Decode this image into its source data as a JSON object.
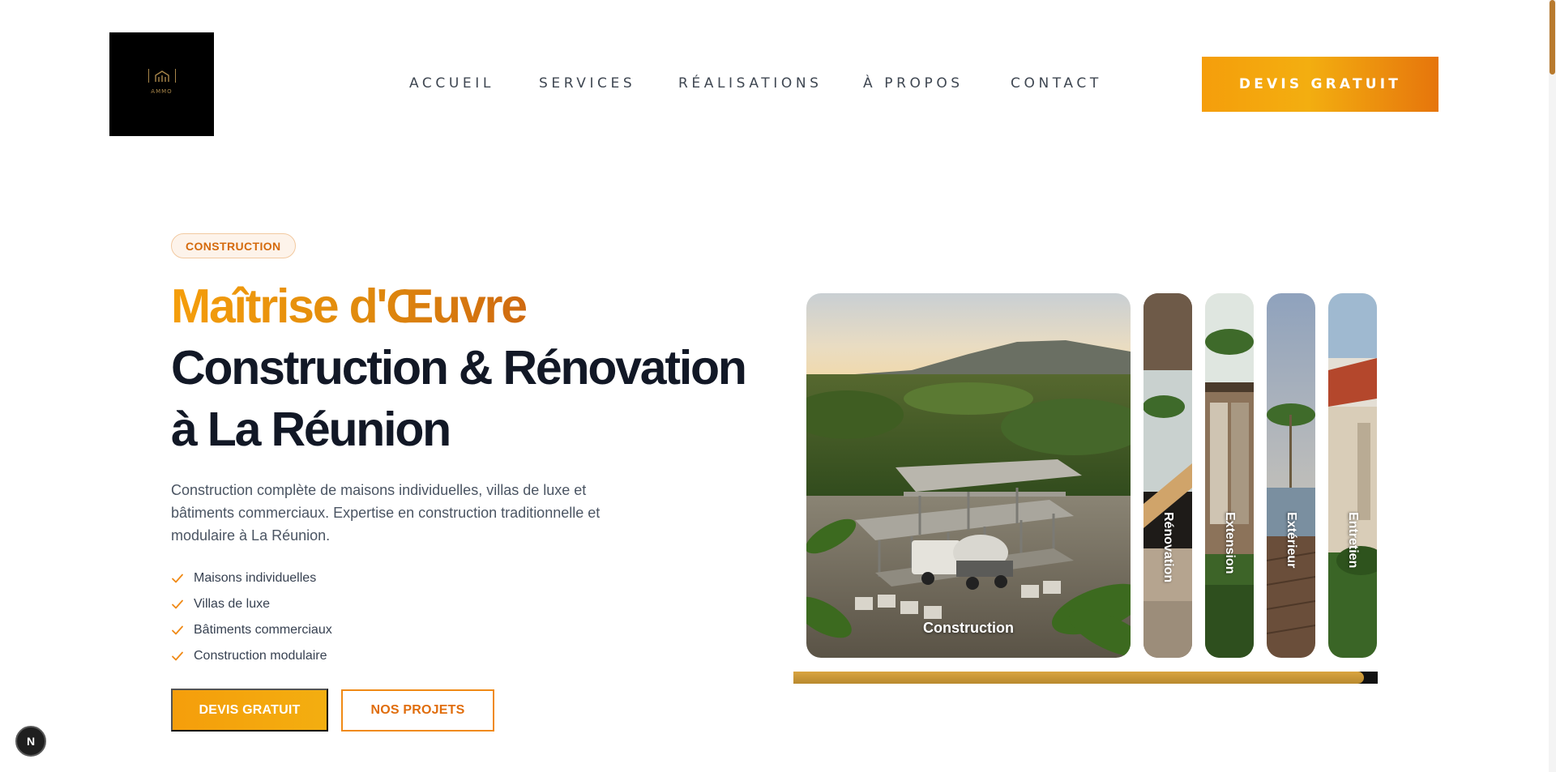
{
  "brand": {
    "logo_text": "AMMO"
  },
  "nav": {
    "items": [
      {
        "label": "ACCUEIL"
      },
      {
        "label": "SERVICES"
      },
      {
        "label": "RÉALISATIONS"
      },
      {
        "label": "À PROPOS"
      },
      {
        "label": "CONTACT"
      }
    ],
    "cta_label": "DEVIS GRATUIT"
  },
  "hero": {
    "badge": "CONSTRUCTION",
    "title_accent": "Maîtrise d'Œuvre",
    "title_line2": "Construction & Rénovation",
    "title_line3": "à La Réunion",
    "description": "Construction complète de maisons individuelles, villas de luxe et bâtiments commerciaux. Expertise en construction traditionnelle et modulaire à La Réunion.",
    "features": [
      "Maisons individuelles",
      "Villas de luxe",
      "Bâtiments commerciaux",
      "Construction modulaire"
    ],
    "primary_button": "DEVIS GRATUIT",
    "secondary_button": "NOS PROJETS"
  },
  "gallery": {
    "active_label": "Construction",
    "collapsed_labels": [
      "Rénovation",
      "Extension",
      "Extérieur",
      "Entretien"
    ],
    "progress": 0.977
  },
  "dev_badge": {
    "label": "N"
  },
  "colors": {
    "accent": "#f59e0b",
    "accent_dark": "#e06d0c",
    "heading": "#121826",
    "text": "#4b5563"
  }
}
